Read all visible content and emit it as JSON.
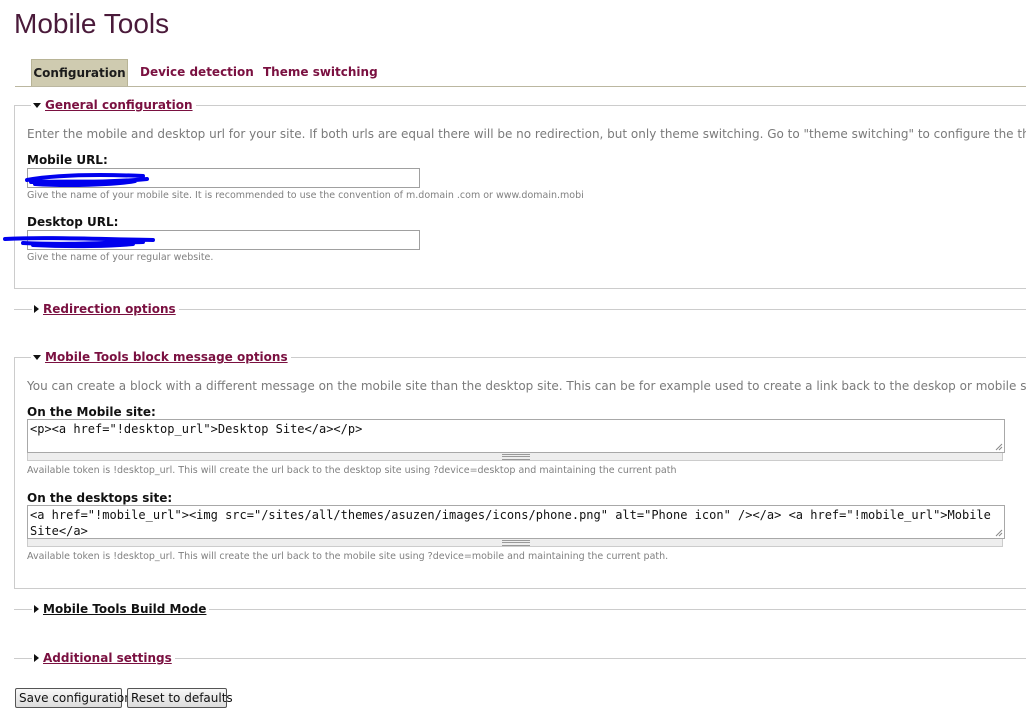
{
  "page": {
    "title": "Mobile Tools"
  },
  "tabs": [
    {
      "label": "Configuration"
    },
    {
      "label": "Device detection"
    },
    {
      "label": "Theme switching"
    }
  ],
  "general": {
    "legend": "General configuration",
    "description": "Enter the mobile and desktop url for your site. If both urls are equal there will be no redirection, but only theme switching. Go to \"theme switching\" to configure the theme.",
    "mobile_url": {
      "label": "Mobile URL:",
      "value": "",
      "hint": "Give the name of your mobile site. It is recommended to use the convention of m.domain .com or www.domain.mobi"
    },
    "desktop_url": {
      "label": "Desktop URL:",
      "value": "",
      "hint": "Give the name of your regular website."
    }
  },
  "redirection": {
    "legend": "Redirection options"
  },
  "block_message": {
    "legend": "Mobile Tools block message options",
    "description": "You can create a block with a different message on the mobile site than the desktop site. This can be for example used to create a link back to the deskop or mobile site.",
    "mobile_site": {
      "label": "On the Mobile site:",
      "value": "<p><a href=\"!desktop_url\">Desktop Site</a></p>",
      "hint": "Available token is !desktop_url. This will create the url back to the desktop site using ?device=desktop and maintaining the current path"
    },
    "desktop_site": {
      "label": "On the desktops site:",
      "value": "<a href=\"!mobile_url\"><img src=\"/sites/all/themes/asuzen/images/icons/phone.png\" alt=\"Phone icon\" /></a> <a href=\"!mobile_url\">Mobile Site</a>",
      "hint": "Available token is !desktop_url. This will create the url back to the mobile site using ?device=mobile and maintaining the current path."
    }
  },
  "build_mode": {
    "legend": "Mobile Tools Build Mode"
  },
  "additional": {
    "legend": "Additional settings"
  },
  "buttons": {
    "save": "Save configuration",
    "reset": "Reset to defaults"
  },
  "colors": {
    "link": "#7a1040",
    "title": "#4a1a3a",
    "active_tab": "#cfcbb0",
    "redaction": "#0000ee"
  }
}
